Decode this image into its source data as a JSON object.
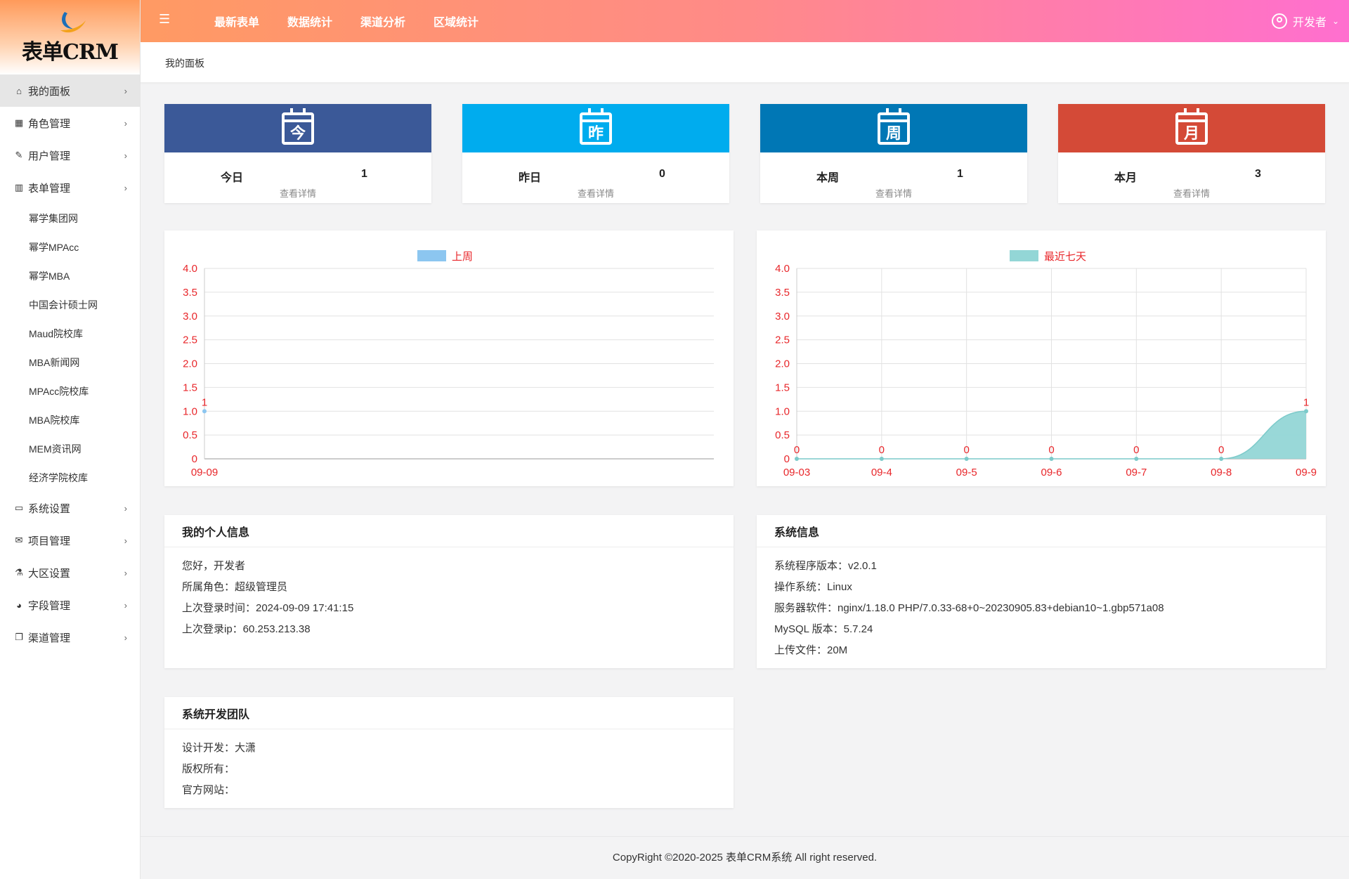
{
  "app": {
    "logo_text": "表单CRM"
  },
  "header": {
    "menu": [
      "最新表单",
      "数据统计",
      "渠道分析",
      "区域统计"
    ],
    "user_name": "开发者"
  },
  "breadcrumb": "我的面板",
  "sidebar": {
    "items": [
      {
        "label": "我的面板",
        "icon": "home-icon",
        "active": true
      },
      {
        "label": "角色管理",
        "icon": "table-icon"
      },
      {
        "label": "用户管理",
        "icon": "edit-icon"
      },
      {
        "label": "表单管理",
        "icon": "bar-chart-icon"
      },
      {
        "label": "系统设置",
        "icon": "desktop-icon"
      },
      {
        "label": "项目管理",
        "icon": "envelope-icon"
      },
      {
        "label": "大区设置",
        "icon": "flask-icon"
      },
      {
        "label": "字段管理",
        "icon": "pie-chart-icon"
      },
      {
        "label": "渠道管理",
        "icon": "copy-icon"
      }
    ],
    "form_sub_items": [
      "幂学集团网",
      "幂学MPAcc",
      "幂学MBA",
      "中国会计硕士网",
      "Maud院校库",
      "MBA新闻网",
      "MPAcc院校库",
      "MBA院校库",
      "MEM资讯网",
      "经济学院校库"
    ]
  },
  "stats": [
    {
      "glyph": "今",
      "label": "今日",
      "value": "1",
      "detail": "查看详情",
      "color": "#3b5998"
    },
    {
      "glyph": "昨",
      "label": "昨日",
      "value": "0",
      "detail": "查看详情",
      "color": "#00acee"
    },
    {
      "glyph": "周",
      "label": "本周",
      "value": "1",
      "detail": "查看详情",
      "color": "#0077b5"
    },
    {
      "glyph": "月",
      "label": "本月",
      "value": "3",
      "detail": "查看详情",
      "color": "#d44a37"
    }
  ],
  "chart_data": [
    {
      "type": "line",
      "series": [
        {
          "name": "上周",
          "values": [
            1
          ]
        }
      ],
      "categories": [
        "09-09"
      ],
      "ylim": [
        0,
        4
      ],
      "yticks": [
        "4.0",
        "3.5",
        "3.0",
        "2.5",
        "2.0",
        "1.5",
        "1.0",
        "0.5",
        "0"
      ],
      "legend_color": "#8cc6f0",
      "grid": "horizontal"
    },
    {
      "type": "area",
      "series": [
        {
          "name": "最近七天",
          "values": [
            0,
            0,
            0,
            0,
            0,
            0,
            1
          ]
        }
      ],
      "categories": [
        "09-03",
        "09-4",
        "09-5",
        "09-6",
        "09-7",
        "09-8",
        "09-9"
      ],
      "ylim": [
        0,
        4
      ],
      "yticks": [
        "4.0",
        "3.5",
        "3.0",
        "2.5",
        "2.0",
        "1.5",
        "1.0",
        "0.5",
        "0"
      ],
      "legend_color": "#93d6d6",
      "grid": "both"
    }
  ],
  "personal": {
    "title": "我的个人信息",
    "lines": [
      "您好，开发者",
      "所属角色：超级管理员",
      "上次登录时间：2024-09-09 17:41:15",
      "上次登录ip：60.253.213.38"
    ]
  },
  "system": {
    "title": "系统信息",
    "lines": [
      "系统程序版本：v2.0.1",
      "操作系统：Linux",
      "服务器软件：nginx/1.18.0  PHP/7.0.33-68+0~20230905.83+debian10~1.gbp571a08",
      "MySQL 版本：5.7.24",
      "上传文件：20M"
    ]
  },
  "team": {
    "title": "系统开发团队",
    "lines": [
      "设计开发：大潇",
      "版权所有：",
      "官方网站："
    ]
  },
  "footer": "CopyRight ©2020-2025 表单CRM系统 All right reserved."
}
